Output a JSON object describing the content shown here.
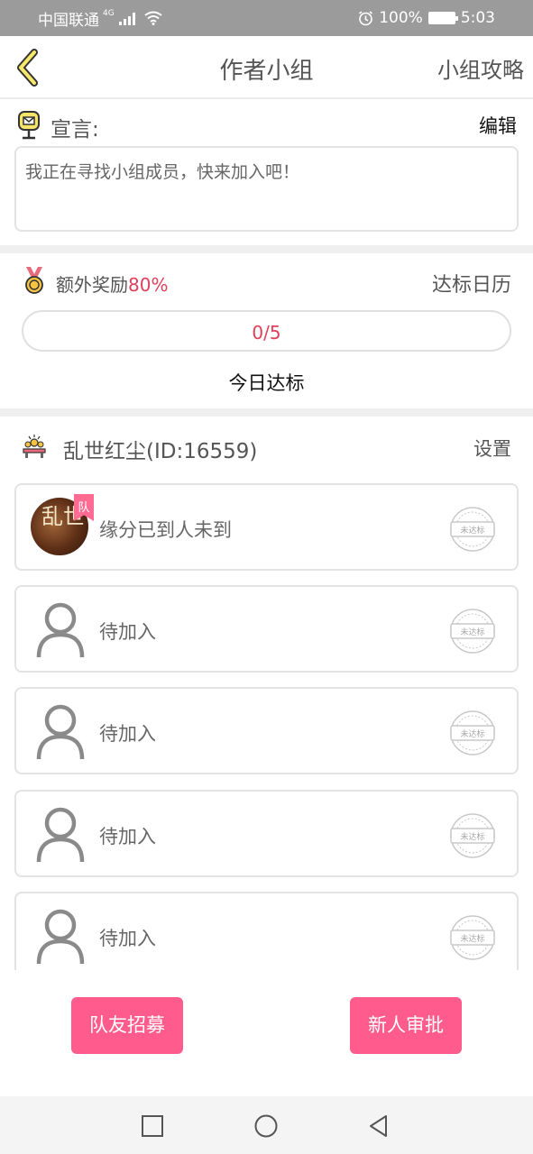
{
  "status_bar": {
    "carrier": "中国联通",
    "network": "4G",
    "battery": "100%",
    "time": "5:03"
  },
  "nav": {
    "title": "作者小组",
    "right_link": "小组攻略"
  },
  "manifesto": {
    "label": "宣言:",
    "edit_label": "编辑",
    "text": "我正在寻找小组成员，快来加入吧！"
  },
  "reward": {
    "label": "额外奖励",
    "percent": "80%",
    "calendar_link": "达标日历",
    "progress_text": "0/5",
    "progress_fraction": 0,
    "today_label": "今日达标"
  },
  "team": {
    "name": "乱世红尘(ID:16559)",
    "settings_label": "设置",
    "captain_badge": "队",
    "avatar_text": "乱世",
    "members": [
      {
        "name": "缘分已到人未到",
        "status": "未达标",
        "has_avatar": true
      },
      {
        "name": "待加入",
        "status": "未达标",
        "has_avatar": false
      },
      {
        "name": "待加入",
        "status": "未达标",
        "has_avatar": false
      },
      {
        "name": "待加入",
        "status": "未达标",
        "has_avatar": false
      },
      {
        "name": "待加入",
        "status": "未达标",
        "has_avatar": false
      }
    ]
  },
  "actions": {
    "recruit_label": "队友招募",
    "approve_label": "新人审批"
  },
  "colors": {
    "accent_pink": "#ff5c8d",
    "percent_red": "#e0405a",
    "status_bar_gray": "#9b9b9b"
  },
  "icons": {
    "back": "back-chevron-icon",
    "manifesto": "mailbox-icon",
    "reward": "medal-icon",
    "team": "team-icon",
    "member_placeholder": "person-icon",
    "member_status": "stamp-icon"
  }
}
